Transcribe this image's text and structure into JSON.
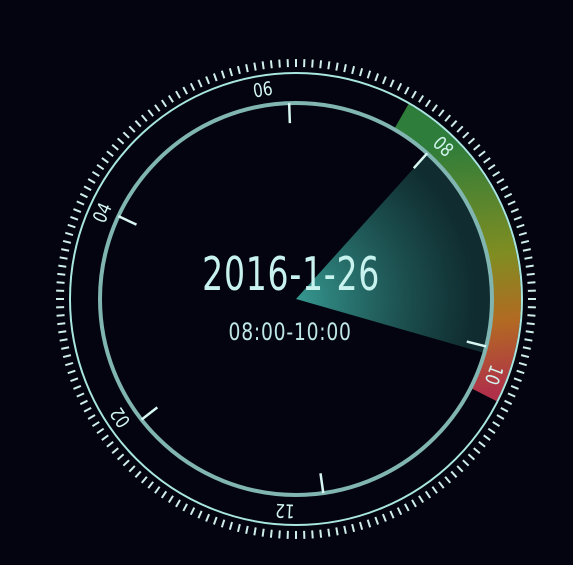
{
  "dial": {
    "date": "2016-1-26",
    "time_range": "08:00-10:00",
    "hour_labels": [
      "06",
      "08",
      "10",
      "12",
      "02",
      "04"
    ],
    "selected_start": "08",
    "selected_end": "10",
    "colors": {
      "background": "#03040f",
      "ring": "#9fe0da",
      "inner_ring": "#7fb8b4",
      "sector": "#2f8f87",
      "highlight_start": "#2f7d3a",
      "highlight_mid": "#8c8a1e",
      "highlight_end": "#b03040",
      "text": "#c8f2ee"
    }
  }
}
